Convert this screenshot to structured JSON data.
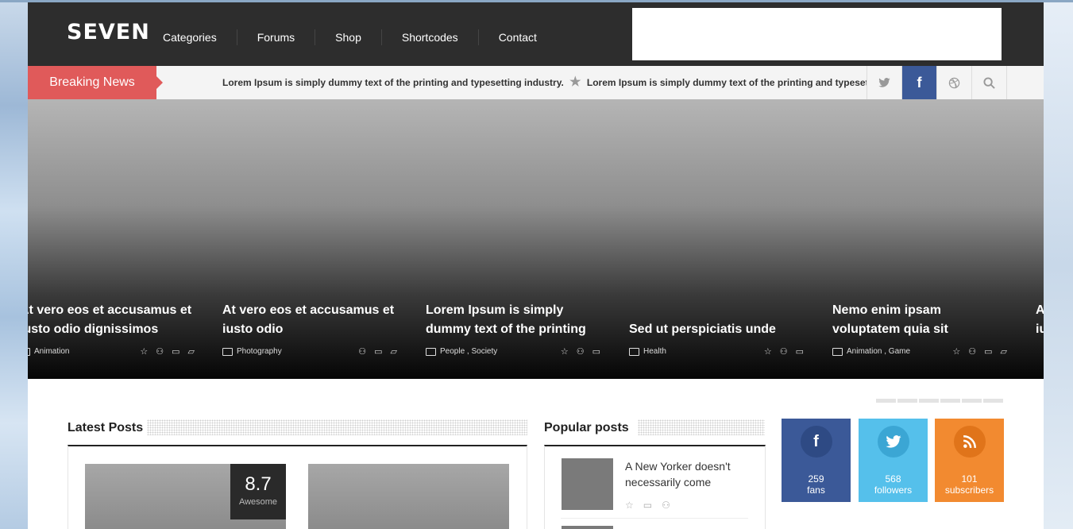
{
  "header": {
    "logo": "SEVEN",
    "nav": [
      "Categories",
      "Forums",
      "Shop",
      "Shortcodes",
      "Contact"
    ]
  },
  "breaking": {
    "label": "Breaking News",
    "items": [
      "Lorem Ipsum is simply dummy text of the printing and typesetting industry.",
      "Lorem Ipsum is simply dummy text of the printing and typesetting indus"
    ],
    "social_icons": [
      "twitter-icon",
      "facebook-icon",
      "dribbble-icon",
      "search-icon"
    ]
  },
  "slider": {
    "slides": [
      {
        "title": "At vero eos et accusamus et iusto odio dignissimos",
        "category": "Animation"
      },
      {
        "title": "At vero eos et accusamus et iusto odio",
        "category": "Photography"
      },
      {
        "title": "Lorem Ipsum is simply dummy text of the printing",
        "category": "People , Society"
      },
      {
        "title": "Sed ut perspiciatis unde",
        "category": "Health"
      },
      {
        "title": "Nemo enim ipsam voluptatem quia sit",
        "category": "Animation , Game"
      },
      {
        "title": "At iu",
        "category": ""
      }
    ]
  },
  "latest": {
    "title": "Latest Posts",
    "score_value": "8.7",
    "score_label": "Awesome"
  },
  "popular": {
    "title": "Popular posts",
    "post_title": "A New Yorker doesn't necessarily come"
  },
  "social_counters": [
    {
      "network": "facebook",
      "count": "259",
      "label": "fans",
      "color": "#3b5998",
      "circle": "#2e4a84"
    },
    {
      "network": "twitter",
      "count": "568",
      "label": "followers",
      "color": "#55c0eb",
      "circle": "#3ba6d4"
    },
    {
      "network": "rss",
      "count": "101",
      "label": "subscribers",
      "color": "#f28a30",
      "circle": "#e0741a"
    }
  ]
}
